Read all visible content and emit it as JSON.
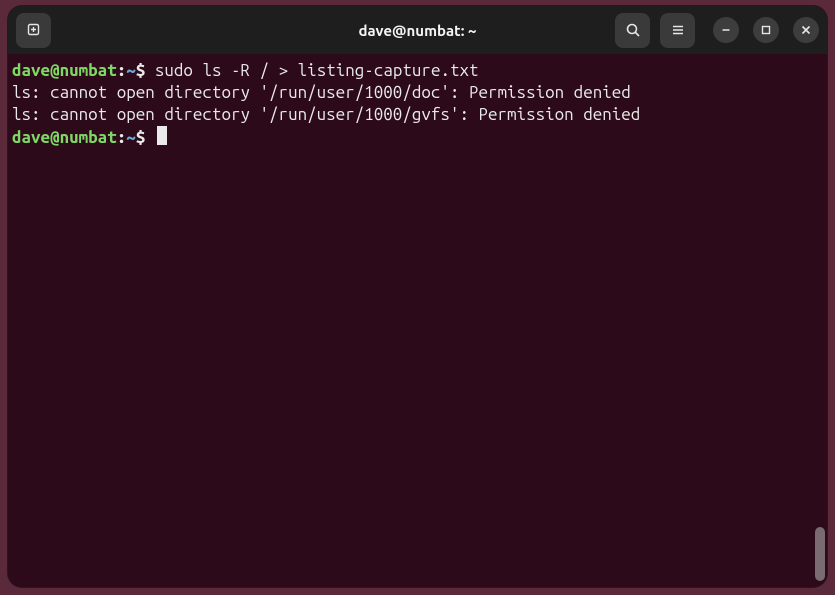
{
  "window": {
    "title": "dave@numbat: ~"
  },
  "icons": {
    "new_tab": "new-tab-icon",
    "search": "search-icon",
    "menu": "menu-icon",
    "minimize": "minimize-icon",
    "maximize": "maximize-icon",
    "close": "close-icon"
  },
  "prompt": {
    "user_host": "dave@numbat",
    "colon": ":",
    "cwd": "~",
    "symbol": "$"
  },
  "lines": [
    {
      "type": "cmd",
      "text": "sudo ls -R / > listing-capture.txt"
    },
    {
      "type": "out",
      "text": "ls: cannot open directory '/run/user/1000/doc': Permission denied"
    },
    {
      "type": "out",
      "text": "ls: cannot open directory '/run/user/1000/gvfs': Permission denied"
    },
    {
      "type": "prompt"
    }
  ]
}
